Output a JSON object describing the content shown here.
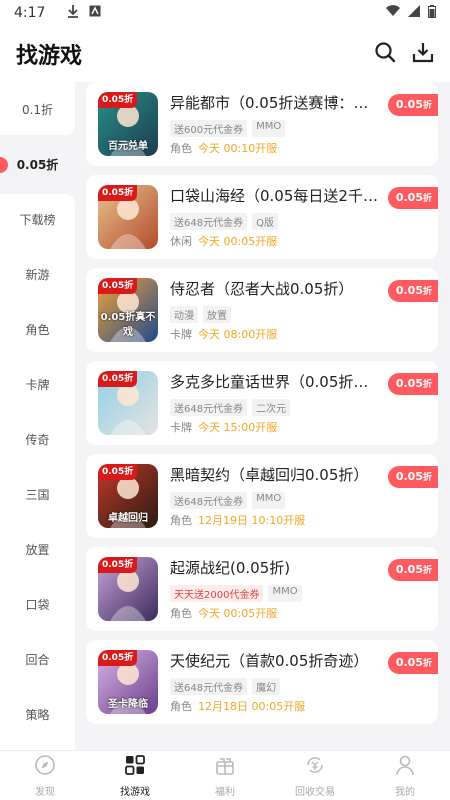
{
  "status": {
    "time": "4:17"
  },
  "header": {
    "title": "找游戏"
  },
  "sidebar": {
    "items": [
      {
        "label": "0.1折"
      },
      {
        "label": "0.05折"
      },
      {
        "label": "下载榜"
      },
      {
        "label": "新游"
      },
      {
        "label": "角色"
      },
      {
        "label": "卡牌"
      },
      {
        "label": "传奇"
      },
      {
        "label": "三国"
      },
      {
        "label": "放置"
      },
      {
        "label": "口袋"
      },
      {
        "label": "回合"
      },
      {
        "label": "策略"
      }
    ],
    "active_index": 1
  },
  "games": [
    {
      "title": "异能都市（0.05折送赛博：黑...",
      "tags": [
        {
          "text": "送600元代金券",
          "red": false
        },
        {
          "text": "MMO",
          "red": false
        }
      ],
      "genre": "角色",
      "open": "今天 00:10开服",
      "discount": "0.05",
      "discount_unit": "折",
      "badge": "0.05折",
      "caption": "百元兑单",
      "colors": [
        "#2a8f8a",
        "#1b3d4d"
      ]
    },
    {
      "title": "口袋山海经（0.05每日送2千代...",
      "tags": [
        {
          "text": "送648元代金券",
          "red": false
        },
        {
          "text": "Q版",
          "red": false
        }
      ],
      "genre": "休闲",
      "open": "今天 00:05开服",
      "discount": "0.05",
      "discount_unit": "折",
      "badge": "0.05折",
      "caption": "",
      "colors": [
        "#e9c48f",
        "#b34a2c"
      ]
    },
    {
      "title": "侍忍者（忍者大战0.05折）",
      "tags": [
        {
          "text": "动漫",
          "red": false
        },
        {
          "text": "放置",
          "red": false
        }
      ],
      "genre": "卡牌",
      "open": "今天 08:00开服",
      "discount": "0.05",
      "discount_unit": "折",
      "badge": "0.05折",
      "caption": "0.05折真不戏",
      "colors": [
        "#f2a23a",
        "#1f4a8a"
      ]
    },
    {
      "title": "多克多比童话世界（0.05折姬...",
      "tags": [
        {
          "text": "送648元代金券",
          "red": false
        },
        {
          "text": "二次元",
          "red": false
        }
      ],
      "genre": "卡牌",
      "open": "今天 15:00开服",
      "discount": "0.05",
      "discount_unit": "折",
      "badge": "0.05折",
      "caption": "",
      "colors": [
        "#8fd0e8",
        "#e7e3df"
      ]
    },
    {
      "title": "黑暗契约（卓越回归0.05折）",
      "tags": [
        {
          "text": "送648元代金券",
          "red": false
        },
        {
          "text": "MMO",
          "red": false
        }
      ],
      "genre": "角色",
      "open": "12月19日 10:10开服",
      "discount": "0.05",
      "discount_unit": "折",
      "badge": "0.05折",
      "caption": "卓越回归",
      "colors": [
        "#c0392b",
        "#2b1b12"
      ]
    },
    {
      "title": "起源战纪(0.05折)",
      "tags": [
        {
          "text": "天天送2000代金券",
          "red": true
        },
        {
          "text": "MMO",
          "red": false
        }
      ],
      "genre": "角色",
      "open": "今天 00:05开服",
      "discount": "0.05",
      "discount_unit": "折",
      "badge": "0.05折",
      "caption": "",
      "colors": [
        "#c7a4d9",
        "#3d2a5c"
      ]
    },
    {
      "title": "天使纪元（首款0.05折奇迹）",
      "tags": [
        {
          "text": "送648元代金券",
          "red": false
        },
        {
          "text": "魔幻",
          "red": false
        }
      ],
      "genre": "角色",
      "open": "12月18日 00:05开服",
      "discount": "0.05",
      "discount_unit": "折",
      "badge": "0.05折",
      "caption": "圣卡降临",
      "colors": [
        "#d8b4e8",
        "#6a3d8a"
      ]
    }
  ],
  "bottom_nav": [
    {
      "label": "发现",
      "icon": "compass-icon"
    },
    {
      "label": "找游戏",
      "icon": "grid-icon"
    },
    {
      "label": "福利",
      "icon": "gift-icon"
    },
    {
      "label": "回收交易",
      "icon": "yen-cycle-icon"
    },
    {
      "label": "我的",
      "icon": "person-icon"
    }
  ],
  "bottom_nav_active": 1,
  "colors": {
    "accent": "#ff5a5f",
    "open_time": "#f5a623",
    "tag_red": "#e64340"
  }
}
